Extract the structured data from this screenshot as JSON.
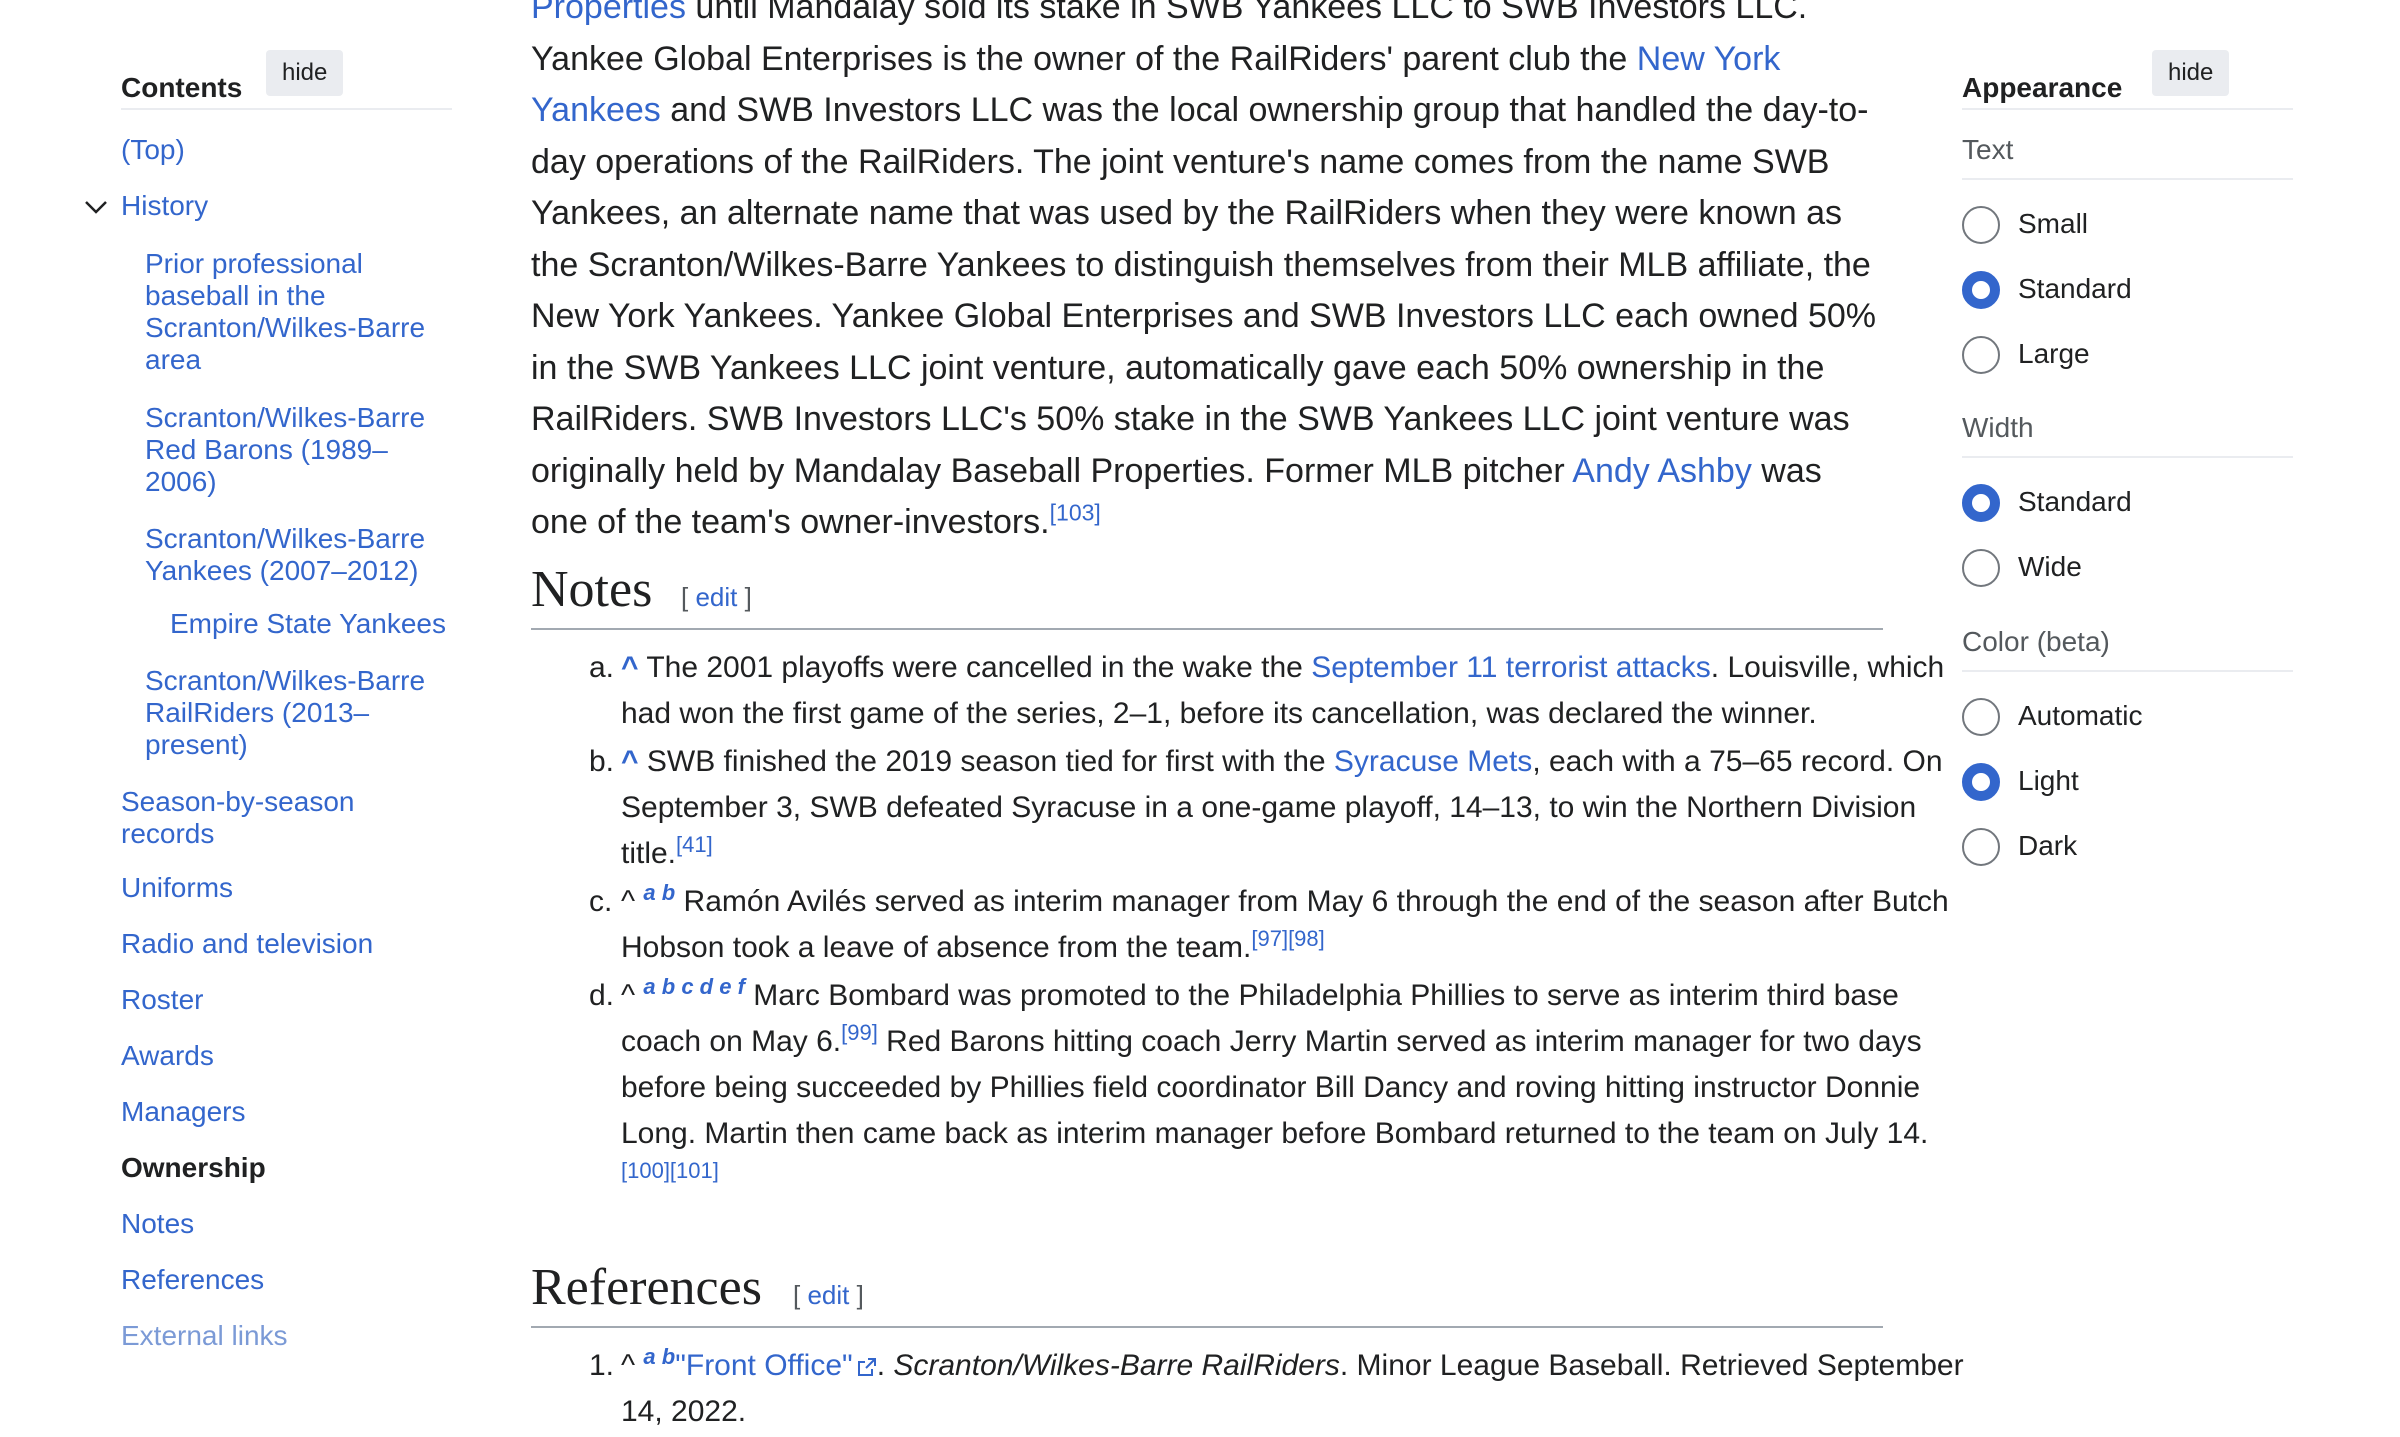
{
  "toc": {
    "title": "Contents",
    "hide_label": "hide",
    "items": [
      {
        "label": "(Top)"
      },
      {
        "label": "History"
      },
      {
        "label": "Prior professional baseball in the Scranton/Wilkes-Barre area"
      },
      {
        "label": "Scranton/Wilkes-Barre Red Barons (1989–2006)"
      },
      {
        "label": "Scranton/Wilkes-Barre Yankees (2007–2012)"
      },
      {
        "label": "Empire State Yankees"
      },
      {
        "label": "Scranton/Wilkes-Barre RailRiders (2013–present)"
      },
      {
        "label": "Season-by-season records"
      },
      {
        "label": "Uniforms"
      },
      {
        "label": "Radio and television"
      },
      {
        "label": "Roster"
      },
      {
        "label": "Awards"
      },
      {
        "label": "Managers"
      },
      {
        "label": "Ownership"
      },
      {
        "label": "Notes"
      },
      {
        "label": "References"
      },
      {
        "label": "External links"
      }
    ]
  },
  "article": {
    "para": {
      "link1": "Properties",
      "t1": " until Mandalay sold its stake in SWB Yankees LLC to SWB Investors LLC. Yankee Global Enterprises is the owner of the RailRiders' parent club the ",
      "link2": "New York Yankees",
      "t2": " and SWB Investors LLC was the local ownership group that handled the day-to-day operations of the RailRiders. The joint venture's name comes from the name SWB Yankees, an alternate name that was used by the RailRiders when they were known as the Scranton/Wilkes-Barre Yankees to distinguish themselves from their MLB affiliate, the New York Yankees. Yankee Global Enterprises and SWB Investors LLC each owned 50% in the SWB Yankees LLC joint venture, automatically gave each 50% ownership in the RailRiders. SWB Investors LLC's 50% stake in the SWB Yankees LLC joint venture was originally held by Mandalay Baseball Properties. Former MLB pitcher ",
      "link3": "Andy Ashby",
      "t3": " was one of the team's owner-investors.",
      "ref": "[103]"
    },
    "notes_heading": "Notes",
    "edit_open": "[",
    "edit_label": "edit",
    "edit_close": "]",
    "notes": [
      {
        "marker": "a.",
        "caret": "^",
        "t1": " The 2001 playoffs were cancelled in the wake the ",
        "link": "September 11 terrorist attacks",
        "t2": ". Louisville, which had won the first game of the series, 2–1, before its cancellation, was declared the winner."
      },
      {
        "marker": "b.",
        "caret": "^",
        "t1": " SWB finished the 2019 season tied for first with the ",
        "link": "Syracuse Mets",
        "t2": ", each with a 75–65 record. On September 3, SWB defeated Syracuse in a one-game playoff, 14–13, to win the Northern Division title.",
        "ref": "[41]"
      },
      {
        "marker": "c.",
        "caret": "^",
        "letters": "a b",
        "t1": " Ramón Avilés served as interim manager from May 6 through the end of the season after Butch Hobson took a leave of absence from the team.",
        "ref": "[97][98]"
      },
      {
        "marker": "d.",
        "caret": "^",
        "letters": "a b c d e f",
        "t1": " Marc Bombard was promoted to the Philadelphia Phillies to serve as interim third base coach on May 6.",
        "ref1": "[99]",
        "t2": " Red Barons hitting coach Jerry Martin served as interim manager for two days before being succeeded by Phillies field coordinator Bill Dancy and roving hitting instructor Donnie Long. Martin then came back as interim manager before Bombard returned to the team on July 14.",
        "ref2": "[100][101]"
      }
    ],
    "refs_heading": "References",
    "refs": [
      {
        "marker": "1.",
        "caret": "^",
        "letters": "a b",
        "link": "\"Front Office\"",
        "t1": ". ",
        "work": "Scranton/Wilkes-Barre RailRiders",
        "t2": ". Minor League Baseball. Retrieved September 14, 2022."
      }
    ]
  },
  "appearance": {
    "title": "Appearance",
    "hide_label": "hide",
    "text_label": "Text",
    "text_options": [
      "Small",
      "Standard",
      "Large"
    ],
    "text_selected": "Standard",
    "width_label": "Width",
    "width_options": [
      "Standard",
      "Wide"
    ],
    "width_selected": "Standard",
    "color_label": "Color (beta)",
    "color_options": [
      "Automatic",
      "Light",
      "Dark"
    ],
    "color_selected": "Light"
  },
  "colors": {
    "link": "#3366cc",
    "text": "#202122",
    "accent": "#3366cc"
  },
  "icons": [
    "chevron-down-icon",
    "external-link-icon"
  ]
}
